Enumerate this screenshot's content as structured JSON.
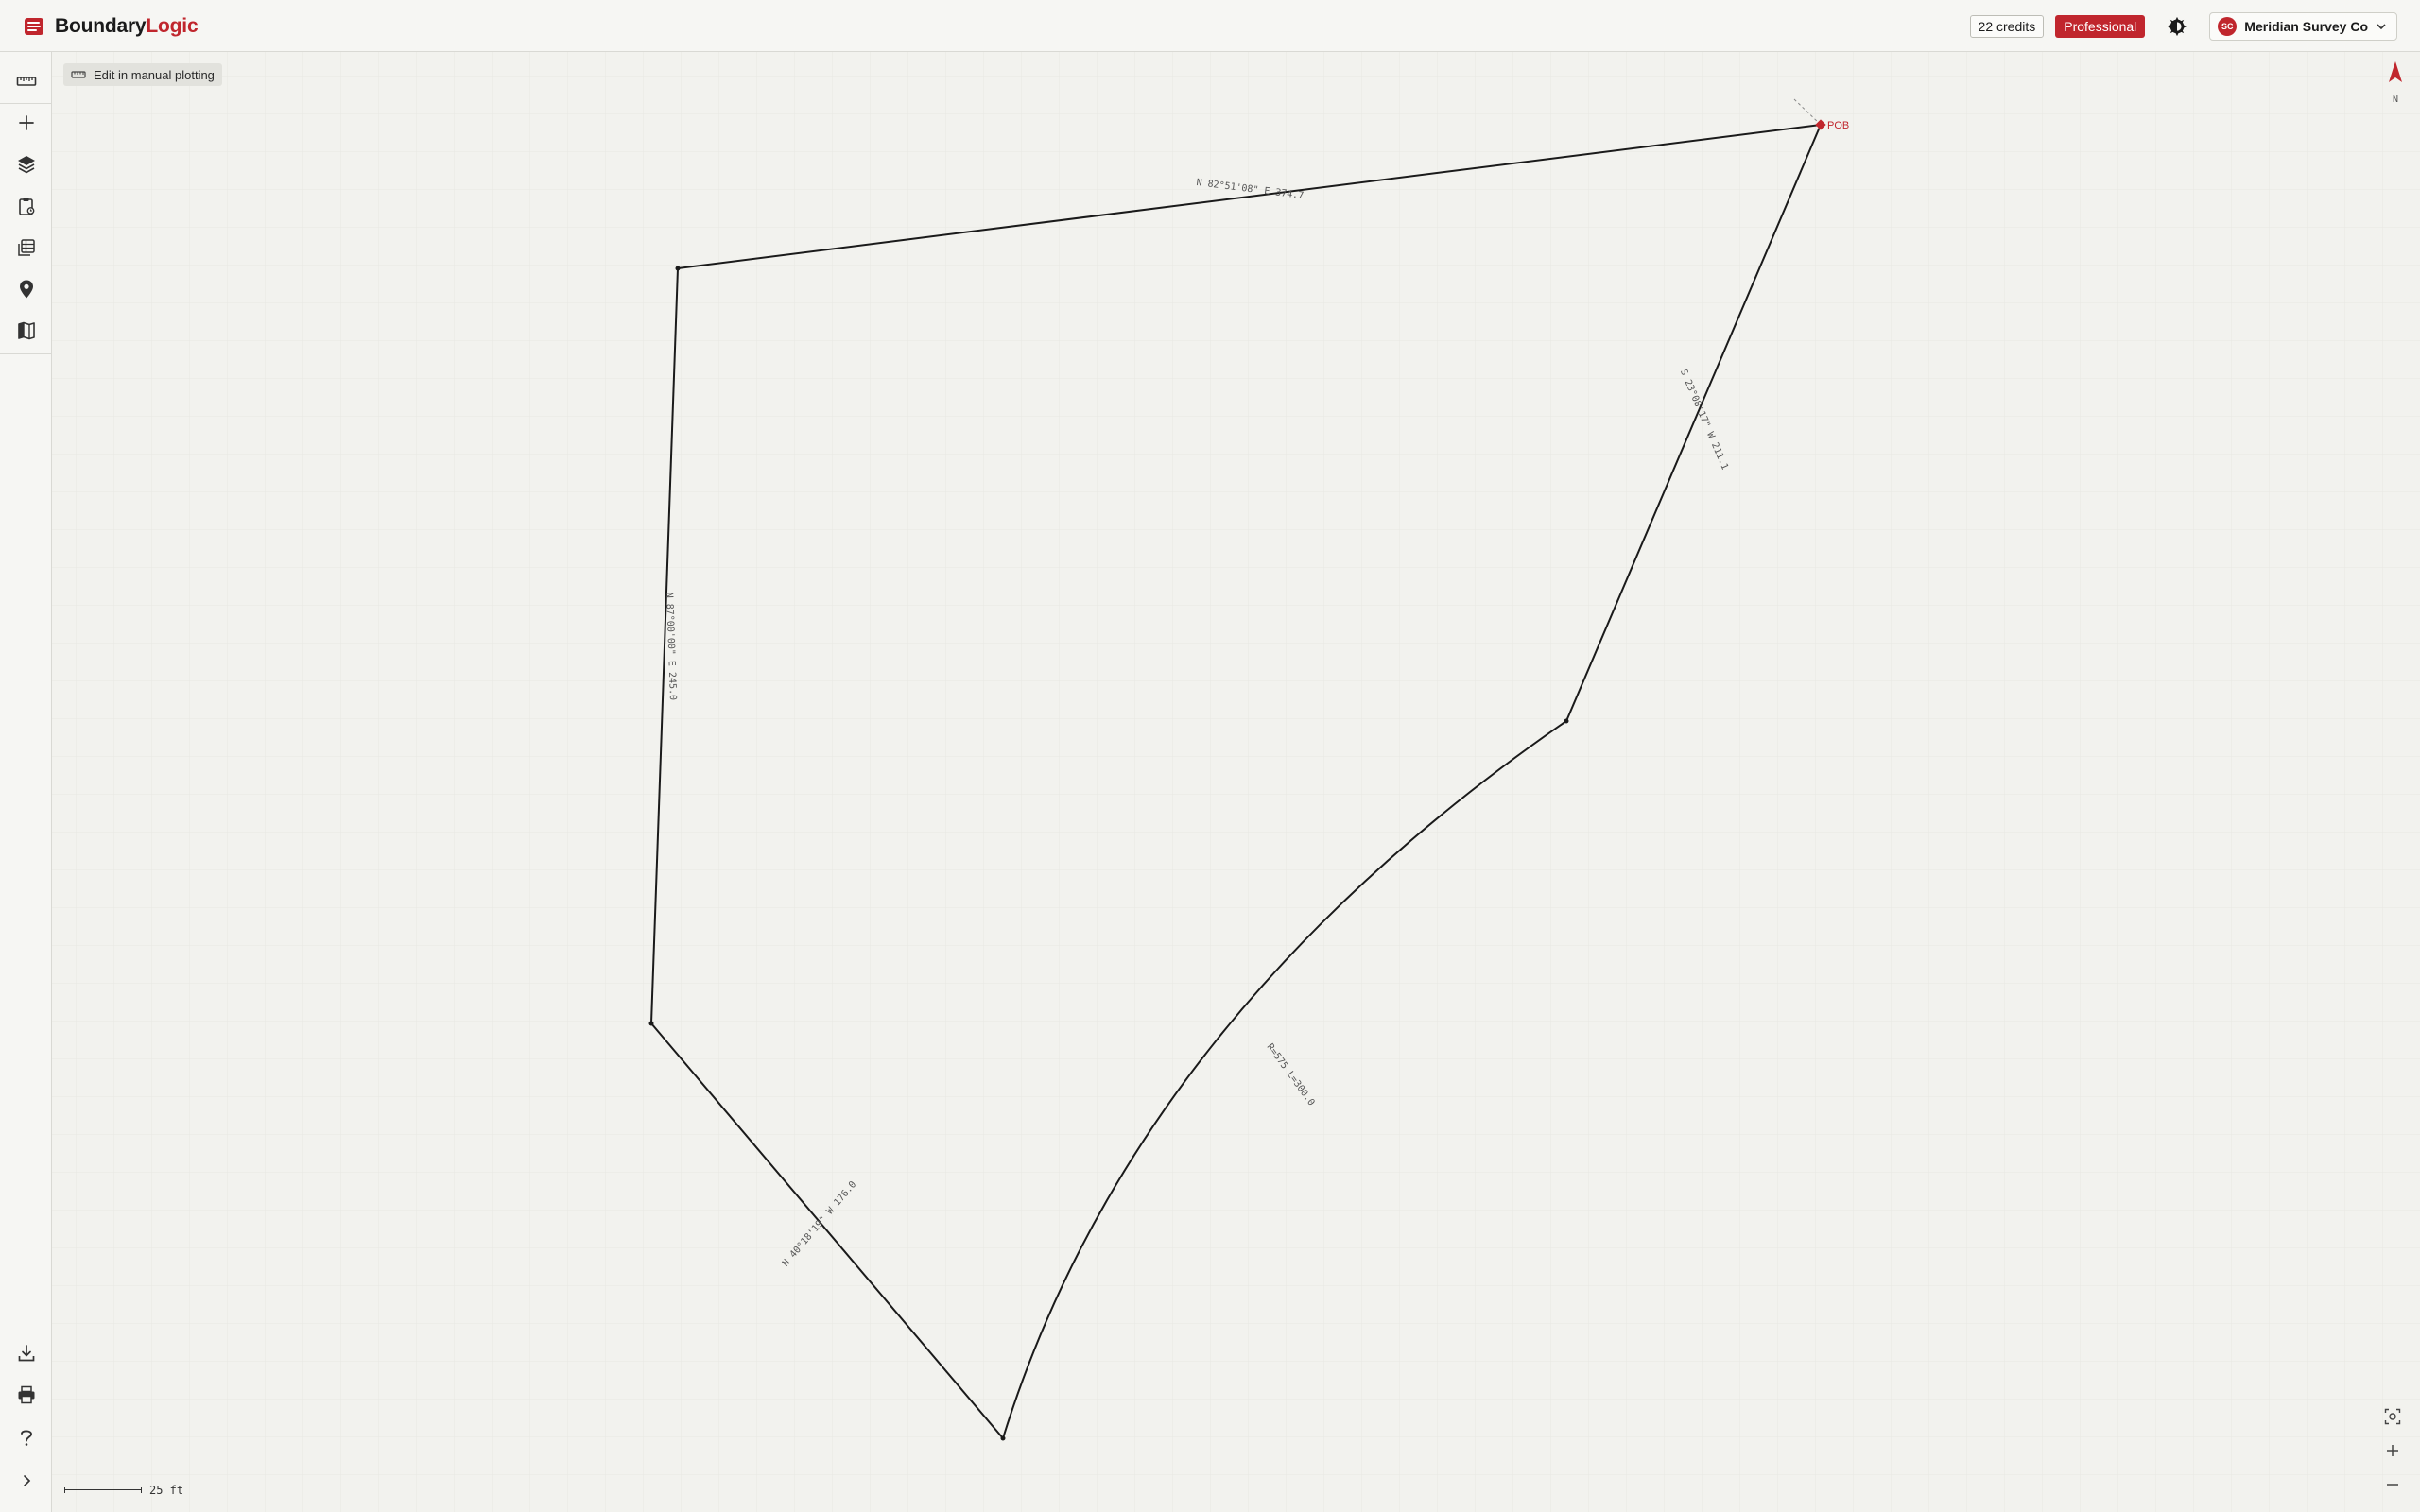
{
  "app": {
    "name_a": "Boundary",
    "name_b": "Logic",
    "brand_color": "#c0262d"
  },
  "header": {
    "credits": "22 credits",
    "plan": "Professional",
    "account": {
      "initials": "SC",
      "name": "Meridian Survey Co"
    }
  },
  "sidebar": {
    "top": [
      {
        "name": "ruler-icon"
      },
      {
        "name": "plus-icon"
      },
      {
        "name": "layers-icon"
      },
      {
        "name": "clipboard-icon"
      },
      {
        "name": "table-icon"
      },
      {
        "name": "location-pin-icon"
      },
      {
        "name": "map-icon"
      }
    ],
    "bottom": [
      {
        "name": "download-icon"
      },
      {
        "name": "print-icon"
      },
      {
        "name": "help-icon"
      },
      {
        "name": "chevron-right-icon"
      }
    ]
  },
  "toolbar": {
    "edit_label": "Edit in manual plotting"
  },
  "map": {
    "pob_label": "POB",
    "calls": [
      "N 82°51'08\" E 374.7",
      "S 23°08'17\" W 211.1",
      "R=575 L=300.0",
      "N 40°18'19\" W 176.0",
      "N 87°00'00\" E 245.0"
    ],
    "scale_label": "25 ft",
    "north_label": "N",
    "line_color": "#1a1a1a",
    "pob_color": "#c0262d"
  }
}
